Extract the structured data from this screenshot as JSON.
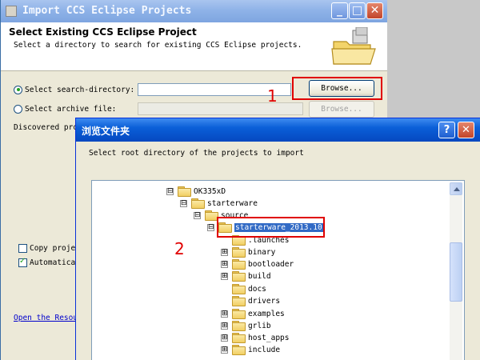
{
  "import_dialog": {
    "title": "Import CCS Eclipse Projects",
    "heading": "Select Existing CCS Eclipse Project",
    "description": "Select a directory to search for existing CCS Eclipse projects.",
    "search_dir_label": "Select search-directory:",
    "search_dir_value": "",
    "search_dir_selected": true,
    "browse_label": "Browse...",
    "archive_label": "Select archive file:",
    "archive_value": "",
    "archive_browse_label": "Browse...",
    "discovered_label": "Discovered pro",
    "copy_label": "Copy projec",
    "copy_checked": false,
    "auto_label": "Automatical",
    "auto_checked": true,
    "link_label": "Open the Resour",
    "window_buttons": [
      "minimize-icon",
      "maximize-icon",
      "close-icon"
    ]
  },
  "folder_dialog": {
    "title": "浏览文件夹",
    "prompt": "Select root directory of the projects to import",
    "window_buttons": [
      "help-icon",
      "close-icon"
    ],
    "tree": [
      {
        "label": "OK335xD",
        "expander": "⊟",
        "level": 0
      },
      {
        "label": "starterware",
        "expander": "⊟",
        "level": 1
      },
      {
        "label": "source",
        "expander": "⊟",
        "level": 2
      },
      {
        "label": "starterware_2013.10",
        "expander": "⊟",
        "level": 3,
        "selected": true
      },
      {
        "label": ".launches",
        "expander": "",
        "level": 4
      },
      {
        "label": "binary",
        "expander": "⊞",
        "level": 4
      },
      {
        "label": "bootloader",
        "expander": "⊞",
        "level": 4
      },
      {
        "label": "build",
        "expander": "⊞",
        "level": 4
      },
      {
        "label": "docs",
        "expander": "",
        "level": 4
      },
      {
        "label": "drivers",
        "expander": "",
        "level": 4
      },
      {
        "label": "examples",
        "expander": "⊞",
        "level": 4
      },
      {
        "label": "grlib",
        "expander": "⊞",
        "level": 4
      },
      {
        "label": "host_apps",
        "expander": "⊞",
        "level": 4
      },
      {
        "label": "include",
        "expander": "⊞",
        "level": 4
      }
    ]
  },
  "annotations": {
    "step1": "1",
    "step2": "2",
    "color": "#e00000"
  },
  "colors": {
    "xp_title_active": "#0a5fd8",
    "xp_title_inactive": "#8fb3e8",
    "dialog_face": "#ece9d8",
    "selection": "#316ac5"
  }
}
